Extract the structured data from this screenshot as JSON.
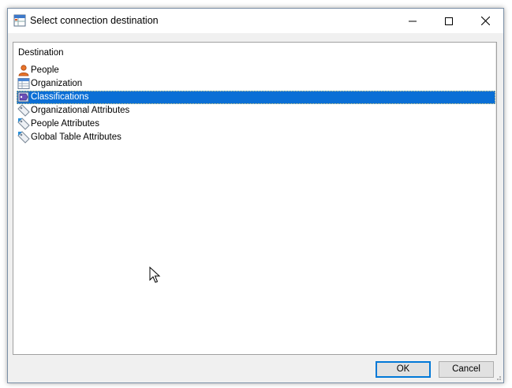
{
  "window": {
    "title": "Select connection destination",
    "icon": "table-window-icon",
    "controls": {
      "minimize": "minimize-icon",
      "maximize": "maximize-icon",
      "close": "close-icon"
    }
  },
  "list": {
    "header": "Destination",
    "items": [
      {
        "label": "People",
        "icon": "person-icon",
        "selected": false
      },
      {
        "label": "Organization",
        "icon": "org-table-icon",
        "selected": false
      },
      {
        "label": "Classifications",
        "icon": "classification-icon",
        "selected": true
      },
      {
        "label": "Organizational Attributes",
        "icon": "attribute-tag-icon",
        "selected": false
      },
      {
        "label": "People Attributes",
        "icon": "attribute-tag-icon",
        "selected": false
      },
      {
        "label": "Global Table Attributes",
        "icon": "attribute-tag-icon",
        "selected": false
      }
    ]
  },
  "buttons": {
    "ok": "OK",
    "cancel": "Cancel"
  },
  "colors": {
    "selection": "#0a6fd6",
    "default_button_border": "#0078d7"
  }
}
